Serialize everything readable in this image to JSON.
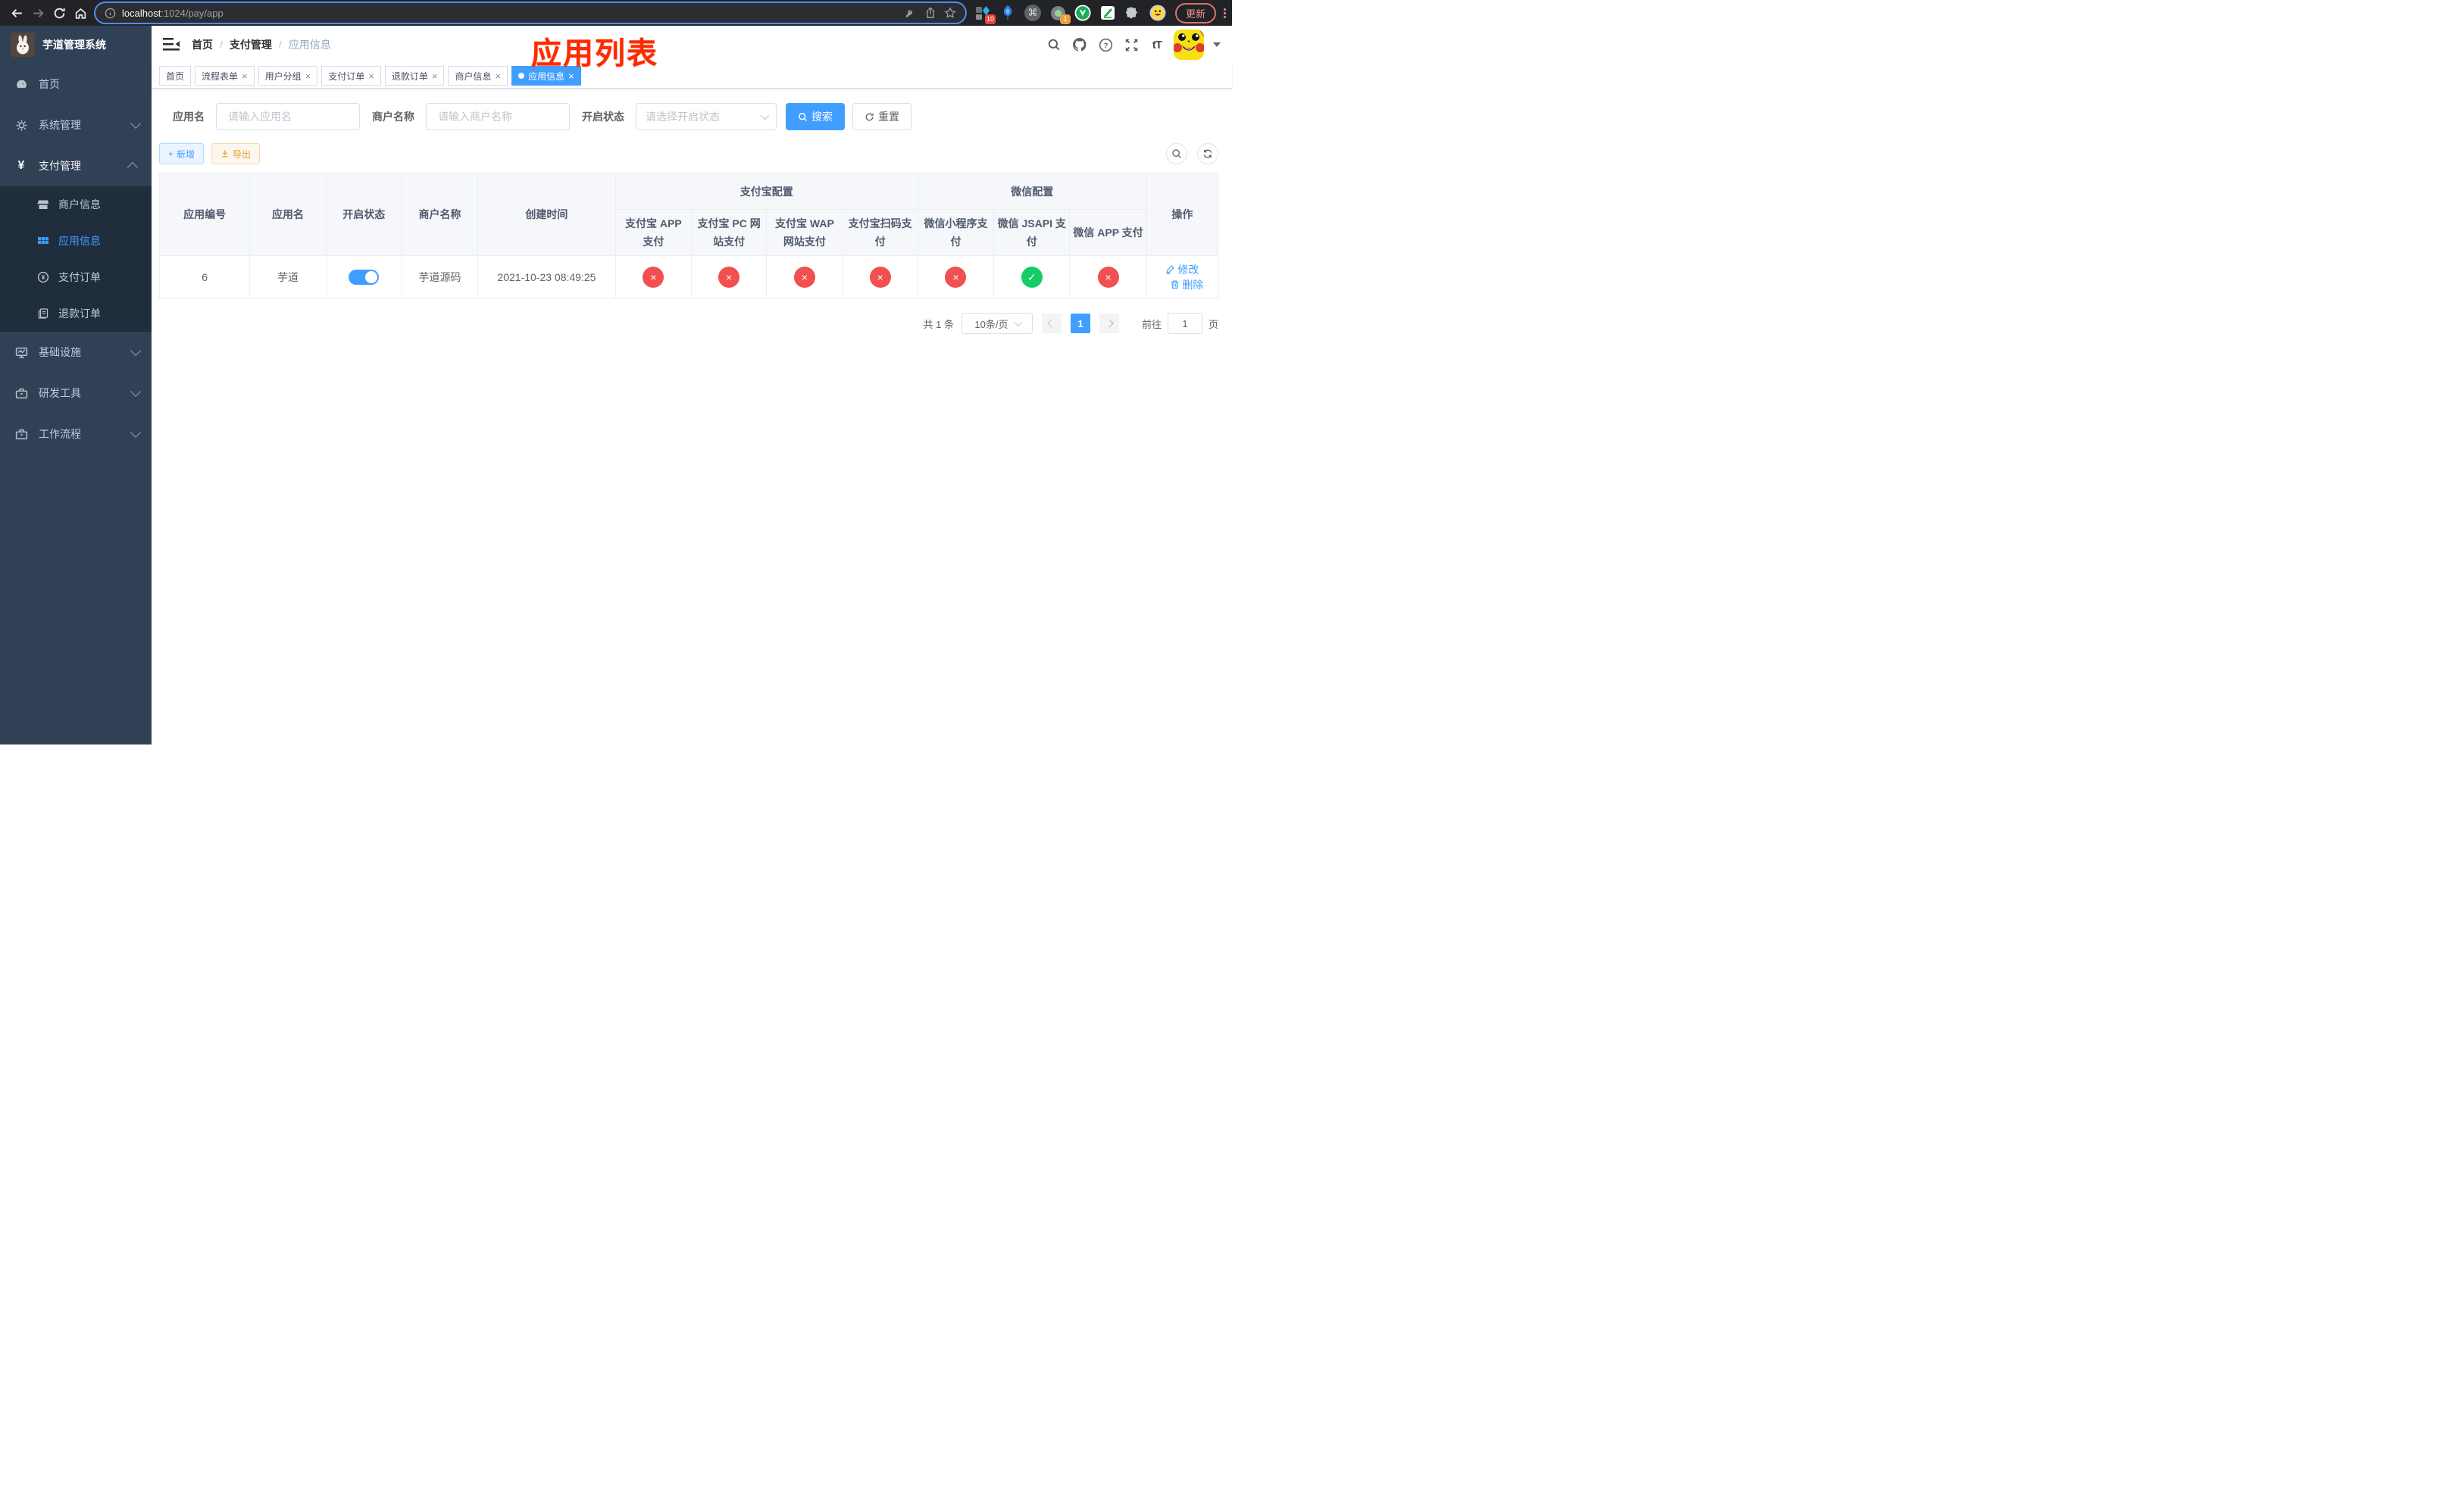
{
  "colors": {
    "accent": "#409eff",
    "success": "#13ce66",
    "danger": "#f24f50",
    "warning": "#e6a23c"
  },
  "icons": {
    "close": "×",
    "check": "✓",
    "cross": "×",
    "yen": "¥",
    "plus": "+",
    "command": "⌘",
    "v_logo": "V",
    "question": "?",
    "font_size": "tT"
  },
  "browser": {
    "url_host": "localhost",
    "url_tail": ":1024/pay/app",
    "ext_badge_a": "10",
    "ext_badge_b": "1",
    "update_label": "更新"
  },
  "annotation": "应用列表",
  "sidebar": {
    "logo_title": "芋道管理系统",
    "items": [
      {
        "label": "首页"
      },
      {
        "label": "系统管理"
      },
      {
        "label": "支付管理"
      },
      {
        "label": "基础设施"
      },
      {
        "label": "研发工具"
      },
      {
        "label": "工作流程"
      }
    ],
    "submenu": [
      {
        "label": "商户信息"
      },
      {
        "label": "应用信息"
      },
      {
        "label": "支付订单"
      },
      {
        "label": "退款订单"
      }
    ]
  },
  "breadcrumb": {
    "items": [
      {
        "label": "首页"
      },
      {
        "label": "支付管理"
      },
      {
        "label": "应用信息"
      }
    ],
    "separator": "/"
  },
  "tags": [
    {
      "label": "首页"
    },
    {
      "label": "流程表单"
    },
    {
      "label": "用户分组"
    },
    {
      "label": "支付订单"
    },
    {
      "label": "退款订单"
    },
    {
      "label": "商户信息"
    },
    {
      "label": "应用信息"
    }
  ],
  "filters": {
    "app_name_label": "应用名",
    "app_name_placeholder": "请输入应用名",
    "merchant_label": "商户名称",
    "merchant_placeholder": "请输入商户名称",
    "status_label": "开启状态",
    "status_placeholder": "请选择开启状态",
    "search_label": "搜索",
    "reset_label": "重置"
  },
  "toolbar": {
    "add_label": "新增",
    "export_label": "导出"
  },
  "table": {
    "columns": {
      "app_id": "应用编号",
      "app_name": "应用名",
      "status": "开启状态",
      "merchant": "商户名称",
      "created": "创建时间",
      "alipay_group": "支付宝配置",
      "alipay": [
        "支付宝 APP 支付",
        "支付宝 PC 网站支付",
        "支付宝 WAP 网站支付",
        "支付宝扫码支付"
      ],
      "wechat_group": "微信配置",
      "wechat": [
        "微信小程序支付",
        "微信 JSAPI 支付",
        "微信 APP 支付"
      ],
      "actions": "操作"
    },
    "row": {
      "app_id": "6",
      "app_name": "芋道",
      "enabled": true,
      "merchant": "芋道源码",
      "created": "2021-10-23 08:49:25",
      "statuses": [
        false,
        false,
        false,
        false,
        false,
        true,
        false
      ],
      "edit_label": "修改",
      "delete_label": "删除"
    }
  },
  "pagination": {
    "total_label": "共 1 条",
    "page_size_label": "10条/页",
    "current_page": "1",
    "goto_label": "前往",
    "goto_value": "1",
    "unit_label": "页"
  }
}
